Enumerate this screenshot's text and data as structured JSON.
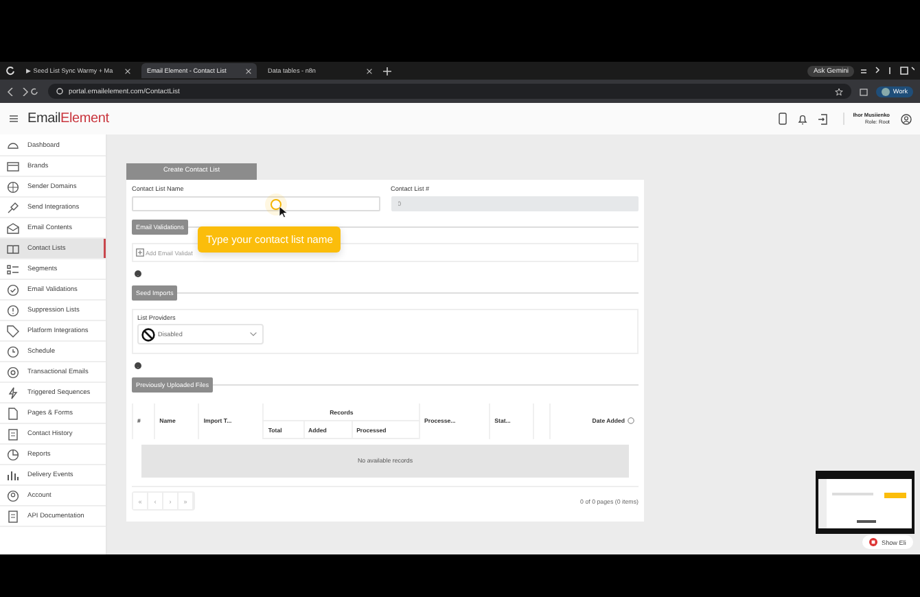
{
  "browser": {
    "tabs": [
      {
        "label": "▶ Seed List Sync Warmy + Ma",
        "selected": false
      },
      {
        "label": "Email Element - Contact List",
        "selected": true
      },
      {
        "label": "Data tables - n8n",
        "selected": false
      }
    ],
    "ask_button": "Ask Gemini",
    "url": "portal.emailelement.com/ContactList",
    "profile": "Work"
  },
  "header": {
    "logo_dark": "Email",
    "logo_red": "Element",
    "user_name": "Ihor Musiienko",
    "user_role": "Role: Root"
  },
  "sidebar": {
    "items": [
      {
        "label": "Dashboard",
        "selected": false
      },
      {
        "label": "Brands",
        "selected": false
      },
      {
        "label": "Sender Domains",
        "selected": false
      },
      {
        "label": "Send Integrations",
        "selected": false
      },
      {
        "label": "Email Contents",
        "selected": false
      },
      {
        "label": "Contact Lists",
        "selected": true
      },
      {
        "label": "Segments",
        "selected": false
      },
      {
        "label": "Email Validations",
        "selected": false
      },
      {
        "label": "Suppression Lists",
        "selected": false
      },
      {
        "label": "Platform Integrations",
        "selected": false
      },
      {
        "label": "Schedule",
        "selected": false
      },
      {
        "label": "Transactional Emails",
        "selected": false
      },
      {
        "label": "Triggered Sequences",
        "selected": false
      },
      {
        "label": "Pages & Forms",
        "selected": false
      },
      {
        "label": "Contact History",
        "selected": false
      },
      {
        "label": "Reports",
        "selected": false
      },
      {
        "label": "Delivery Events",
        "selected": false
      },
      {
        "label": "Account",
        "selected": false
      },
      {
        "label": "API Documentation",
        "selected": false
      }
    ]
  },
  "form": {
    "title": "Create Contact List",
    "fields": [
      {
        "label": "Contact List Name",
        "disabled": false
      },
      {
        "label": "Contact List #",
        "value": "0",
        "disabled": true
      }
    ],
    "email_validations": {
      "button": "Email Validations",
      "add_link": "Add Email Validat"
    },
    "seed_imports": {
      "button": "Seed Imports",
      "providers_label": "List Providers",
      "provider_value": "Disabled"
    },
    "uploads": {
      "button": "Previously Uploaded Files"
    }
  },
  "tooltip": "Type your contact list name",
  "table": {
    "group_header": "Records",
    "columns": [
      {
        "label": "#",
        "kind": "single"
      },
      {
        "label": "Name",
        "kind": "single"
      },
      {
        "label": "Import T...",
        "kind": "single"
      },
      {
        "label": "Total",
        "kind": "grouped"
      },
      {
        "label": "Added",
        "kind": "grouped"
      },
      {
        "label": "Processed",
        "kind": "grouped"
      },
      {
        "label": "Processe...",
        "kind": "single"
      },
      {
        "label": "Stat...",
        "kind": "single"
      },
      {
        "label": "Date Added",
        "kind": "single"
      }
    ],
    "empty_text": "No available records",
    "pager": [
      "«",
      "‹",
      "›",
      "»"
    ],
    "page_info": "0 of 0 pages (0 items)"
  },
  "show_button": "Show Eli"
}
